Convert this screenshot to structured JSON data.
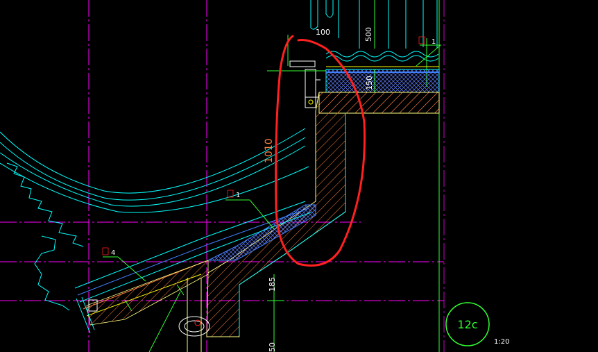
{
  "drawing": {
    "dimensions": {
      "d100": "100",
      "d500": "500",
      "d150": "150",
      "d1010": "1010",
      "d185": "185",
      "d50": "50"
    },
    "labels": {
      "tile": "1",
      "mat1": "1",
      "mat4": "4"
    },
    "detail": {
      "number": "12c",
      "scale": "1:20"
    }
  },
  "colors": {
    "background": "#000000",
    "outline_cyan": "#00ffff",
    "hatch_orange": "#ff8040",
    "axis_magenta": "#ff00ff",
    "annotation_red": "#ff2020",
    "leader_green": "#33ff33",
    "insulation_blue": "#4080ff"
  }
}
